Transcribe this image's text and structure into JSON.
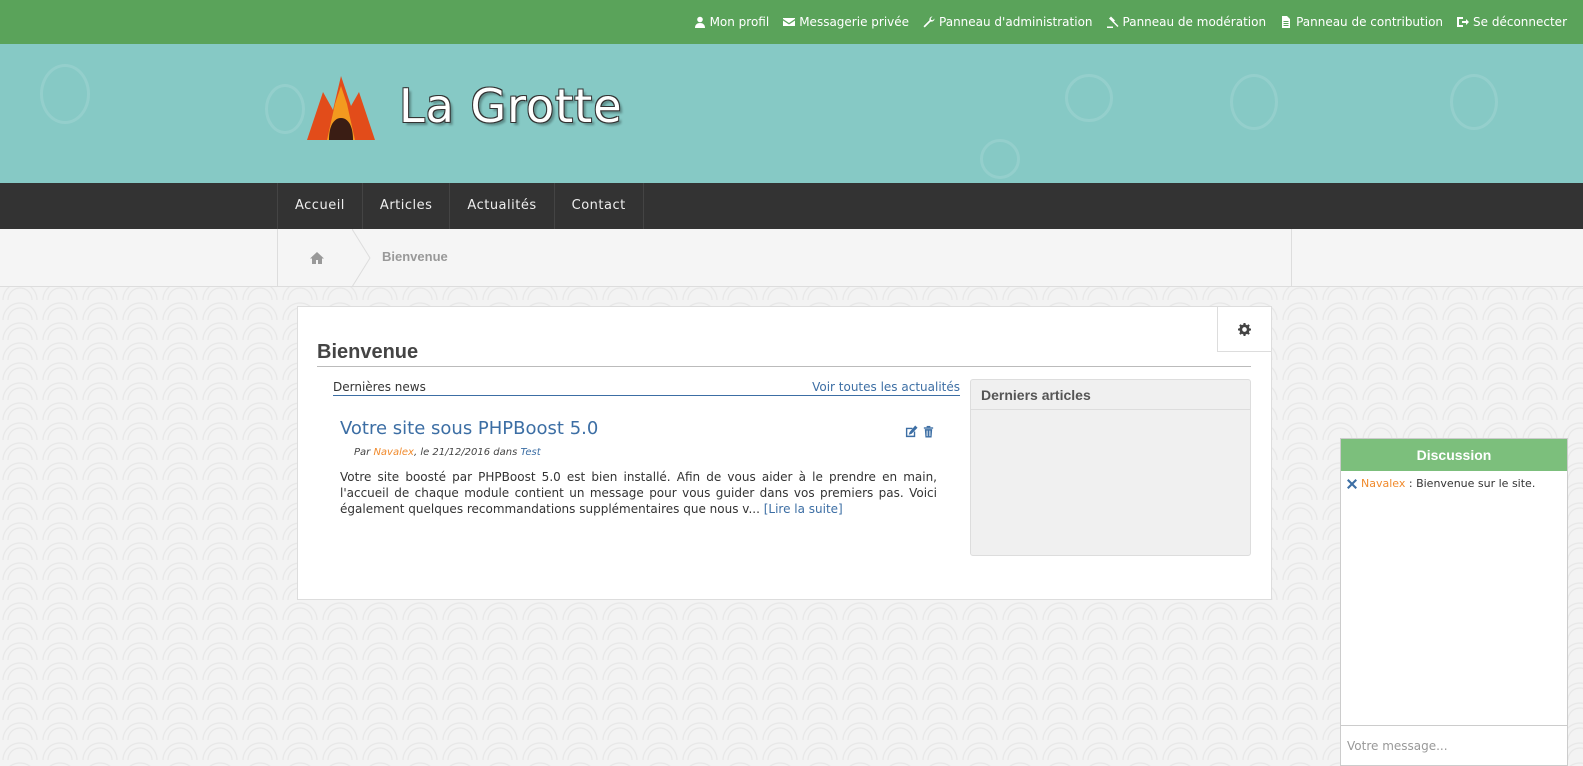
{
  "topbar": {
    "items": [
      {
        "label": "Mon profil",
        "icon": "user-icon"
      },
      {
        "label": "Messagerie privée",
        "icon": "envelope-icon"
      },
      {
        "label": "Panneau d'administration",
        "icon": "wrench-icon"
      },
      {
        "label": "Panneau de modération",
        "icon": "gavel-icon"
      },
      {
        "label": "Panneau de contribution",
        "icon": "file-icon"
      },
      {
        "label": "Se déconnecter",
        "icon": "sign-out-icon"
      }
    ]
  },
  "header": {
    "site_title": "La Grotte",
    "colors": {
      "banner": "#86c9c5",
      "topbar": "#5aa35a",
      "nav": "#333333"
    }
  },
  "nav": {
    "items": [
      "Accueil",
      "Articles",
      "Actualités",
      "Contact"
    ]
  },
  "breadcrumb": {
    "home_icon": "home-icon",
    "current": "Bienvenue"
  },
  "main": {
    "title": "Bienvenue",
    "news": {
      "heading": "Dernières news",
      "see_all": "Voir toutes les actualités",
      "item": {
        "title": "Votre site sous PHPBoost 5.0",
        "meta_prefix": "Par ",
        "author": "Navalex",
        "meta_date": ", le 21/12/2016 dans ",
        "category": "Test",
        "body": "Votre site boosté par PHPBoost 5.0 est bien installé. Afin de vous aider à le prendre en main, l'accueil de chaque module contient un message pour vous guider dans vos premiers pas. Voici également quelques recommandations supplémentaires que nous v... ",
        "read_more": "[Lire la suite]"
      }
    },
    "sidebar": {
      "title": "Derniers articles"
    }
  },
  "chat": {
    "title": "Discussion",
    "messages": [
      {
        "user": "Navalex",
        "separator": " : ",
        "text": "Bienvenue sur le site."
      }
    ],
    "placeholder": "Votre message..."
  }
}
